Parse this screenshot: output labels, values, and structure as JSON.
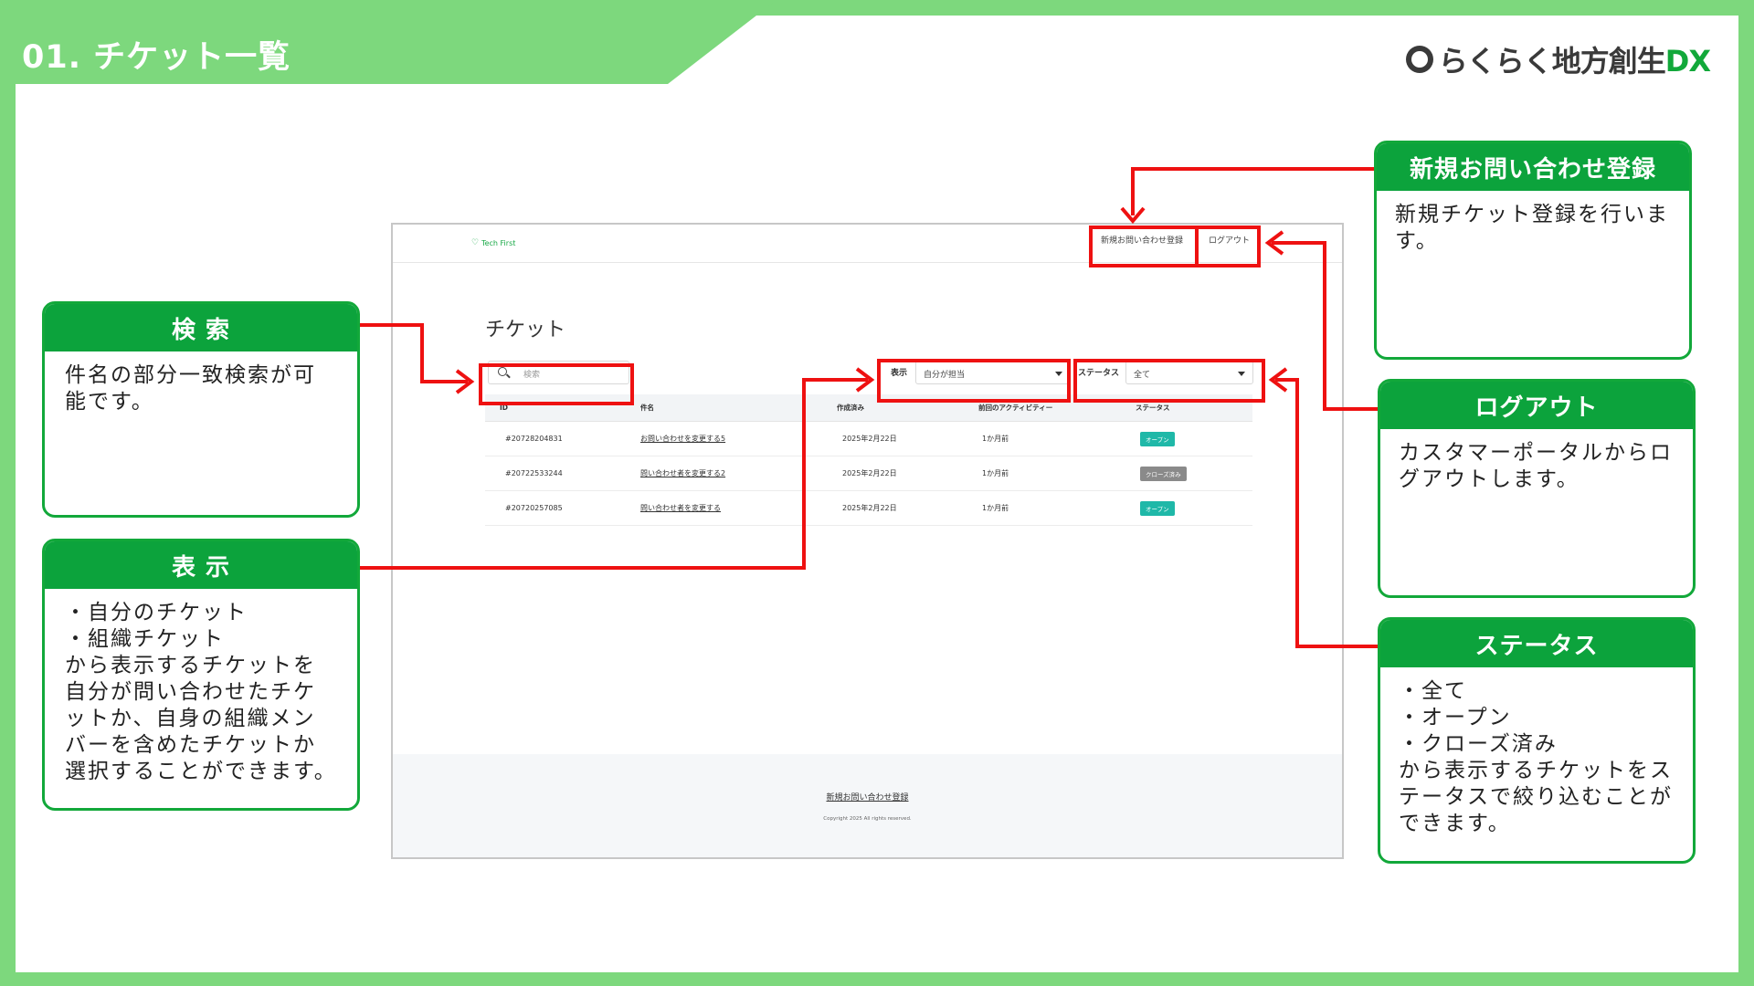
{
  "slide": {
    "title": "01. チケット一覧",
    "logo": {
      "prefix": "らくらく地方創生",
      "suffix": "DX"
    }
  },
  "app": {
    "brand": "Tech First",
    "nav": {
      "new_inquiry": "新規お問い合わせ登録",
      "logout": "ログアウト"
    },
    "heading": "チケット",
    "search": {
      "placeholder": "検索"
    },
    "view_filter": {
      "label": "表示",
      "value": "自分が担当"
    },
    "status_filter": {
      "label": "ステータス",
      "value": "全て"
    },
    "table": {
      "headers": [
        "ID",
        "件名",
        "作成済み",
        "前回のアクティビティー",
        "ステータス"
      ],
      "rows": [
        {
          "id": "#20728204831",
          "subject": "お問い合わせを変更する5",
          "created": "2025年2月22日",
          "activity": "1か月前",
          "status": "オープン",
          "status_type": "open"
        },
        {
          "id": "#20722533244",
          "subject": "問い合わせ者を変更する2",
          "created": "2025年2月22日",
          "activity": "1か月前",
          "status": "クローズ済み",
          "status_type": "closed"
        },
        {
          "id": "#20720257085",
          "subject": "問い合わせ者を変更する",
          "created": "2025年2月22日",
          "activity": "1か月前",
          "status": "オープン",
          "status_type": "open"
        }
      ]
    },
    "footer": {
      "link": "新規お問い合わせ登録",
      "copyright": "Copyright 2025 All rights reserved."
    }
  },
  "callouts": {
    "search": {
      "title": "検 索",
      "body": "件名の部分一致検索が可能です。"
    },
    "view": {
      "title": "表 示",
      "body": "・自分のチケット\n・組織チケット\nから表示するチケットを自分が問い合わせたチケットか、自身の組織メンバーを含めたチケットか選択することができます。"
    },
    "new_inquiry": {
      "title": "新規お問い合わせ登録",
      "body": "新規チケット登録を行います。"
    },
    "logout": {
      "title": "ログアウト",
      "body": "カスタマーポータルからログアウトします。"
    },
    "status": {
      "title": "ステータス",
      "body": "・全て\n・オープン\n・クローズ済み\nから表示するチケットをステータスで絞り込むことができます。"
    }
  },
  "colors": {
    "frame": "#7dd87d",
    "callout": "#0ca33c",
    "highlight": "#ee1111",
    "badge_open": "#1fb8a8",
    "badge_closed": "#8a8a8a"
  }
}
